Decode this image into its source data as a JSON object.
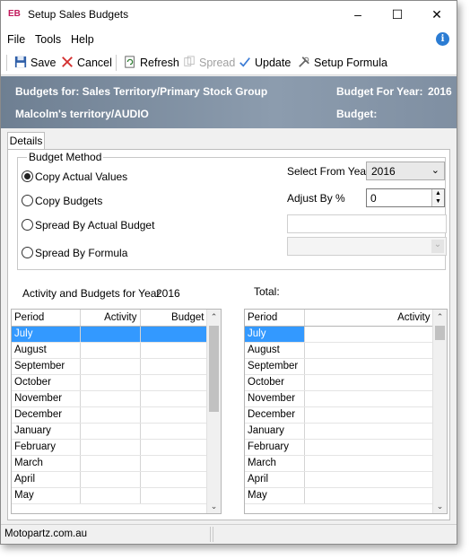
{
  "window": {
    "app_badge": "EB",
    "title": "Setup Sales Budgets"
  },
  "menu": {
    "items": [
      "File",
      "Tools",
      "Help"
    ]
  },
  "toolbar": {
    "save": "Save",
    "cancel": "Cancel",
    "refresh": "Refresh",
    "spread": "Spread",
    "update": "Update",
    "setup_formula": "Setup Formula"
  },
  "header": {
    "budgets_for": "Budgets for: Sales Territory/Primary Stock Group",
    "territory": "Malcolm's territory/AUDIO",
    "budget_for_year_label": "Budget For Year:",
    "budget_for_year_value": "2016",
    "budget_label": "Budget:"
  },
  "tabs": {
    "details": "Details"
  },
  "budget_method": {
    "legend": "Budget Method",
    "options": [
      "Copy Actual Values",
      "Copy Budgets",
      "Spread By Actual Budget",
      "Spread By Formula"
    ],
    "selected": "Copy Actual Values",
    "select_from_year_label": "Select From Year",
    "select_from_year_value": "2016",
    "adjust_by_label": "Adjust By %",
    "adjust_by_value": "0"
  },
  "left_grid": {
    "caption": "Activity and Budgets for Year",
    "year": "2016",
    "columns": [
      "Period",
      "Activity",
      "Budget"
    ],
    "rows": [
      "July",
      "August",
      "September",
      "October",
      "November",
      "December",
      "January",
      "February",
      "March",
      "April",
      "May"
    ]
  },
  "right_grid": {
    "caption": "Total:",
    "columns": [
      "Period",
      "Activity"
    ],
    "rows": [
      "July",
      "August",
      "September",
      "October",
      "November",
      "December",
      "January",
      "February",
      "March",
      "April",
      "May"
    ]
  },
  "status": {
    "company": "Motopartz.com.au"
  }
}
